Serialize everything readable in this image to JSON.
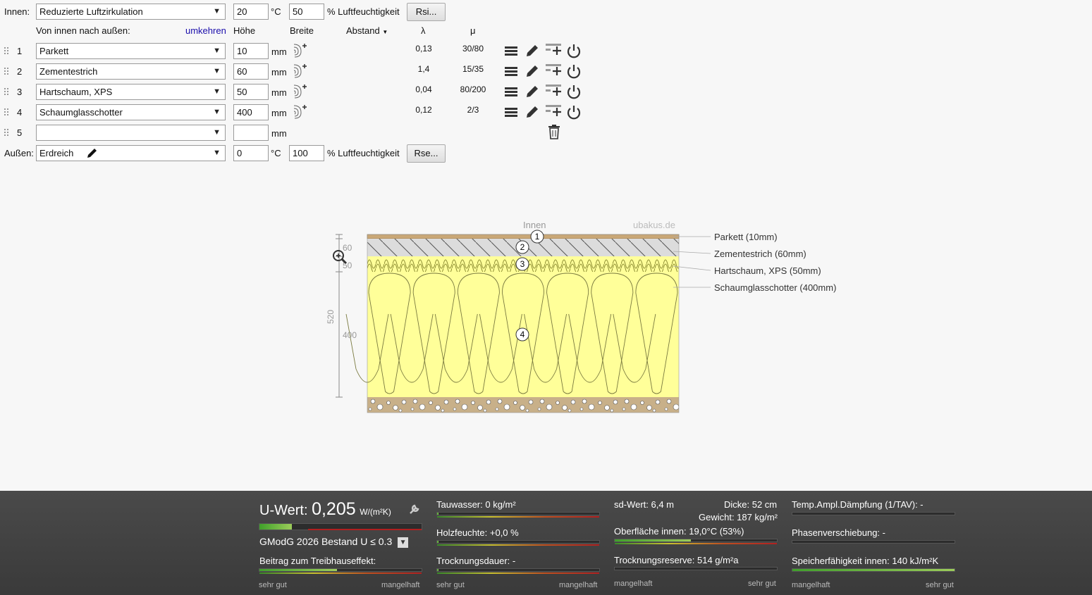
{
  "inside": {
    "label": "Innen:",
    "climate": "Reduzierte Luftzirkulation",
    "temp": "20",
    "temp_unit": "°C",
    "humidity": "50",
    "humidity_label": "% Luftfeuchtigkeit",
    "rsi_button": "Rsi..."
  },
  "header": {
    "direction": "Von innen nach außen:",
    "reverse": "umkehren",
    "height": "Höhe",
    "width": "Breite",
    "distance": "Abstand",
    "lambda": "λ",
    "mu": "μ"
  },
  "layers": [
    {
      "num": "1",
      "material": "Parkett",
      "thickness": "10",
      "unit": "mm",
      "lambda": "0,13",
      "mu": "30/80"
    },
    {
      "num": "2",
      "material": "Zementestrich",
      "thickness": "60",
      "unit": "mm",
      "lambda": "1,4",
      "mu": "15/35"
    },
    {
      "num": "3",
      "material": "Hartschaum, XPS",
      "thickness": "50",
      "unit": "mm",
      "lambda": "0,04",
      "mu": "80/200"
    },
    {
      "num": "4",
      "material": "Schaumglasschotter",
      "thickness": "400",
      "unit": "mm",
      "lambda": "0,12",
      "mu": "2/3"
    },
    {
      "num": "5",
      "material": "",
      "thickness": "",
      "unit": "mm",
      "lambda": "",
      "mu": ""
    }
  ],
  "outside": {
    "label": "Außen:",
    "climate": "Erdreich",
    "temp": "0",
    "temp_unit": "°C",
    "humidity": "100",
    "humidity_label": "% Luftfeuchtigkeit",
    "rse_button": "Rse..."
  },
  "diagram": {
    "inside_label": "Innen",
    "watermark": "ubakus.de",
    "dim_total": "520",
    "dim_60": "60",
    "dim_50": "50",
    "dim_400": "400",
    "callouts": [
      "Parkett (10mm)",
      "Zementestrich (60mm)",
      "Hartschaum, XPS (50mm)",
      "Schaumglasschotter (400mm)"
    ],
    "markers": [
      "1",
      "2",
      "3",
      "4"
    ]
  },
  "results": {
    "u_label": "U-Wert:",
    "u_value": "0,205",
    "u_unit": "W/(m²K)",
    "u_bar_fraction": 0.2,
    "standard": "GModG 2026 Bestand U ≤ 0.3",
    "greenhouse": "Beitrag zum Treibhauseffekt:",
    "dew": "Tauwasser: 0 kg/m²",
    "wood_moisture": "Holzfeuchte: +0,0 %",
    "drying_time": "Trocknungsdauer: -",
    "sd": "sd-Wert: 6,4 m",
    "thickness": "Dicke: 52 cm",
    "weight": "Gewicht: 187 kg/m²",
    "surface": "Oberfläche innen: 19,0°C (53%)",
    "drying_reserve": "Trocknungsreserve: 514 g/m²a",
    "tav": "Temp.Ampl.Dämpfung (1/TAV): -",
    "phase": "Phasenverschiebung: -",
    "storage": "Speicherfähigkeit innen: 140 kJ/m²K",
    "good": "sehr gut",
    "bad": "mangelhaft"
  }
}
